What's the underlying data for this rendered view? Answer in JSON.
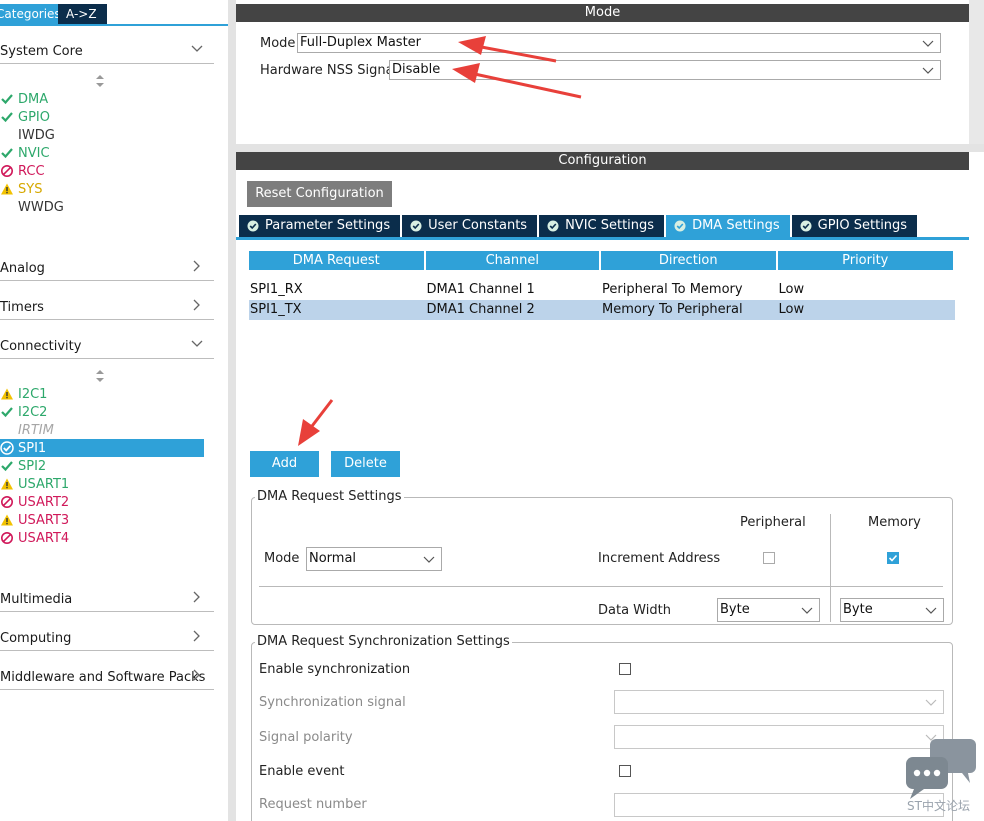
{
  "left": {
    "tabs": [
      {
        "label": "Categories"
      },
      {
        "label": "A->Z"
      }
    ],
    "categories": [
      {
        "label": "System Core"
      },
      {
        "label": "Analog"
      },
      {
        "label": "Timers"
      },
      {
        "label": "Connectivity"
      },
      {
        "label": "Multimedia"
      },
      {
        "label": "Computing"
      },
      {
        "label": "Middleware and Software Packs"
      }
    ],
    "system_core": [
      {
        "name": "DMA",
        "status": "ok"
      },
      {
        "name": "GPIO",
        "status": "ok"
      },
      {
        "name": "IWDG",
        "status": "none"
      },
      {
        "name": "NVIC",
        "status": "ok"
      },
      {
        "name": "RCC",
        "status": "conflict"
      },
      {
        "name": "SYS",
        "status": "warning"
      },
      {
        "name": "WWDG",
        "status": "none"
      }
    ],
    "connectivity": [
      {
        "name": "I2C1",
        "status": "warning"
      },
      {
        "name": "I2C2",
        "status": "ok"
      },
      {
        "name": "IRTIM",
        "status": "unavailable"
      },
      {
        "name": "SPI1",
        "status": "ok-selected"
      },
      {
        "name": "SPI2",
        "status": "ok"
      },
      {
        "name": "USART1",
        "status": "warning"
      },
      {
        "name": "USART2",
        "status": "conflict"
      },
      {
        "name": "USART3",
        "status": "warning"
      },
      {
        "name": "USART4",
        "status": "conflict"
      }
    ]
  },
  "mode": {
    "title": "Mode",
    "mode_label": "Mode",
    "mode_value": "Full-Duplex Master",
    "nss_label": "Hardware NSS Signal",
    "nss_value": "Disable"
  },
  "config": {
    "title": "Configuration",
    "reset_label": "Reset Configuration",
    "tabs": [
      {
        "label": "Parameter Settings"
      },
      {
        "label": "User Constants"
      },
      {
        "label": "NVIC Settings"
      },
      {
        "label": "DMA Settings"
      },
      {
        "label": "GPIO Settings"
      }
    ],
    "active_tab": "DMA Settings"
  },
  "dma_table": {
    "headers": [
      "DMA Request",
      "Channel",
      "Direction",
      "Priority"
    ],
    "rows": [
      [
        "SPI1_RX",
        "DMA1 Channel 1",
        "Peripheral To Memory",
        "Low"
      ],
      [
        "SPI1_TX",
        "DMA1 Channel 2",
        "Memory To Peripheral",
        "Low"
      ]
    ],
    "selected_row": 1
  },
  "buttons": {
    "add": "Add",
    "delete": "Delete"
  },
  "request_settings": {
    "title": "DMA Request Settings",
    "peripheral_col": "Peripheral",
    "memory_col": "Memory",
    "mode_label": "Mode",
    "mode_value": "Normal",
    "increment_label": "Increment Address",
    "increment_peripheral": false,
    "increment_memory": true,
    "width_label": "Data Width",
    "width_peripheral": "Byte",
    "width_memory": "Byte"
  },
  "sync_settings": {
    "title": "DMA Request Synchronization Settings",
    "enable_sync": "Enable synchronization",
    "sync_signal": "Synchronization signal",
    "signal_polarity": "Signal polarity",
    "enable_event": "Enable event",
    "request_number": "Request number"
  },
  "watermark": "ST中文论坛",
  "colors": {
    "accent": "#2fa1d8",
    "navy": "#0b2d4b",
    "ok": "#2da86b",
    "conflict": "#d0195a",
    "warning": "#f2c200",
    "annotation": "#e8403a"
  }
}
